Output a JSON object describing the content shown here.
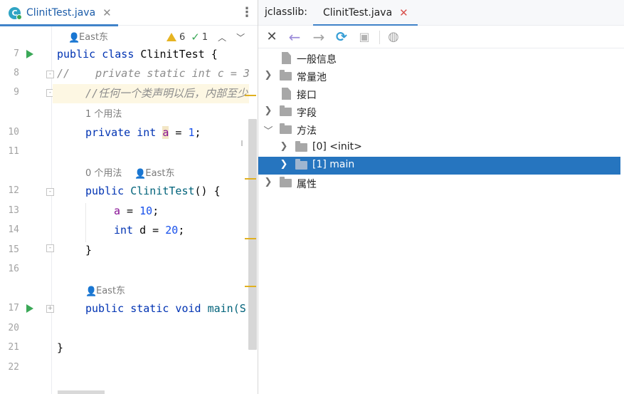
{
  "editor": {
    "tab": {
      "file_name": "ClinitTest.java",
      "icon_letter": "C"
    },
    "inspections": {
      "warnings": "6",
      "weak_warnings": "1"
    },
    "line_numbers": [
      "7",
      "8",
      "9",
      "10",
      "11",
      "12",
      "13",
      "14",
      "15",
      "16",
      "17",
      "20",
      "21",
      "22"
    ],
    "hints": {
      "author_top": "East东",
      "usages_field": "1 个用法",
      "usages_ctor": "0 个用法",
      "author_ctor": "East东",
      "author_main": "East东"
    },
    "code": {
      "l7_kw": "public class",
      "l7_name": "ClinitTest {",
      "l8_comment": "//    private static int c = 3",
      "l9_comment": "//任何一个类声明以后，内部至少",
      "l10_kw": "private int",
      "l10_var": "a",
      "l10_rest": " = ",
      "l10_num": "1",
      "l10_end": ";",
      "l12_kw": "public",
      "l12_name": "ClinitTest",
      "l12_rest": "() {",
      "l13_var": "a",
      "l13_rest": " = ",
      "l13_num": "10",
      "l13_end": ";",
      "l14_kw": "int",
      "l14_rest": " d = ",
      "l14_num": "20",
      "l14_end": ";",
      "l15": "}",
      "l17_kw": "public static void",
      "l17_name": "main(S",
      "l21": "}"
    }
  },
  "jclasslib": {
    "prefix": "jclasslib:",
    "tab_label": "ClinitTest.java",
    "toolbar": [
      "close-icon",
      "back-arrow-icon",
      "forward-arrow-icon",
      "refresh-icon",
      "save-icon",
      "browser-icon"
    ],
    "tree": [
      {
        "label": "一般信息",
        "kind": "file"
      },
      {
        "label": "常量池",
        "kind": "folder",
        "state": "collapsed"
      },
      {
        "label": "接口",
        "kind": "file"
      },
      {
        "label": "字段",
        "kind": "folder",
        "state": "collapsed"
      },
      {
        "label": "方法",
        "kind": "folder",
        "state": "expanded"
      },
      {
        "label": "[0] <init>",
        "kind": "folder",
        "state": "collapsed"
      },
      {
        "label": "[1] main",
        "kind": "folder",
        "state": "collapsed",
        "selected": true
      },
      {
        "label": "属性",
        "kind": "folder",
        "state": "collapsed"
      }
    ]
  },
  "colors": {
    "accent": "#4083c9",
    "selection": "#2675bf",
    "keyword": "#0033b3",
    "number": "#1750eb",
    "field": "#871094",
    "comment": "#8c8c8c",
    "run": "#3aa857",
    "warning": "#e6b422"
  }
}
